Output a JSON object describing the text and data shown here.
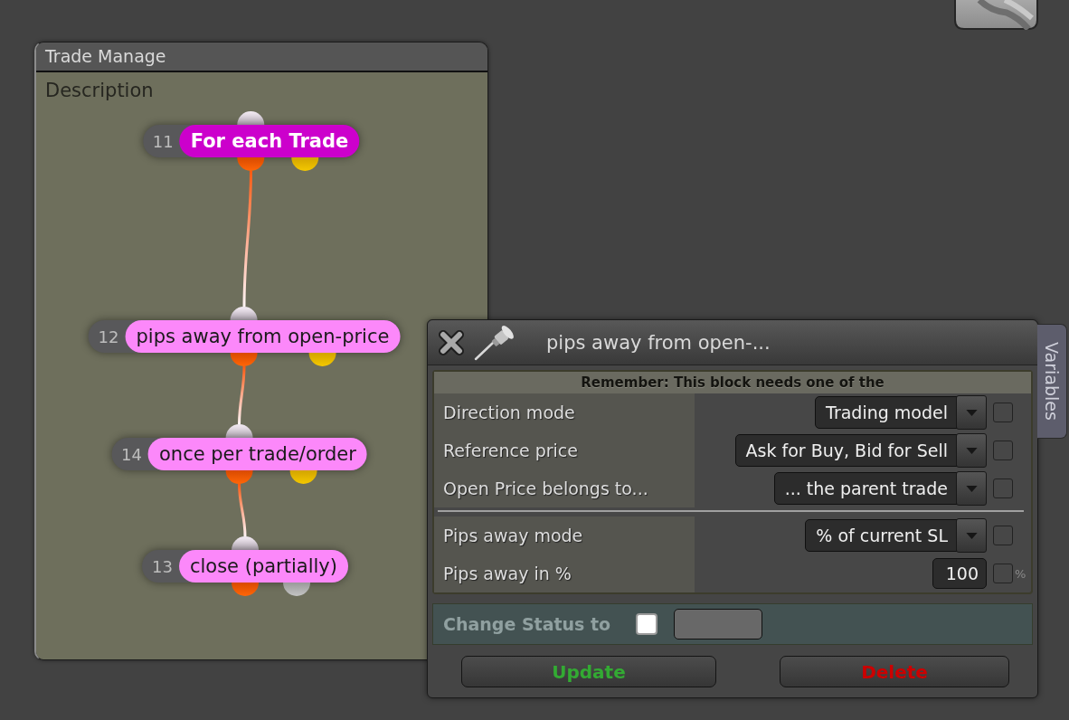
{
  "flow_window": {
    "title": "Trade Manage",
    "description": "Description",
    "blocks": [
      {
        "number": "11",
        "label": "For each Trade",
        "kind": "loop",
        "children": [
          {
            "number": "12",
            "label": "pips away from open-price",
            "kind": "condition",
            "children": [
              {
                "number": "14",
                "label": "once per trade/order",
                "kind": "condition",
                "children": [
                  {
                    "number": "13",
                    "label": "close (partially)",
                    "kind": "action"
                  }
                ]
              }
            ]
          }
        ]
      }
    ]
  },
  "block_dialog": {
    "title": "pips away from open-...",
    "side_tab": "Variables",
    "notice": "Remember: This block needs one of the",
    "groups": [
      {
        "rows": [
          {
            "label": "Direction mode",
            "kind": "dropdown",
            "value": "Trading model",
            "checked": false
          },
          {
            "label": "Reference price",
            "kind": "dropdown",
            "value": "Ask for Buy, Bid for Sell",
            "checked": false
          },
          {
            "label": "Open Price belongs to...",
            "kind": "dropdown",
            "value": "... the parent trade",
            "checked": false
          }
        ]
      },
      {
        "rows": [
          {
            "label": "Pips away mode",
            "kind": "dropdown",
            "value": "% of current SL",
            "checked": false
          },
          {
            "label": "Pips away in %",
            "kind": "number",
            "value": "100",
            "checked": false,
            "unit": "%"
          }
        ]
      }
    ],
    "change_status": {
      "label": "Change Status to",
      "checked": false
    },
    "buttons": [
      {
        "label": "Update",
        "color": "#33aa33"
      },
      {
        "label": "Delete",
        "color": "#cc0000"
      }
    ]
  }
}
